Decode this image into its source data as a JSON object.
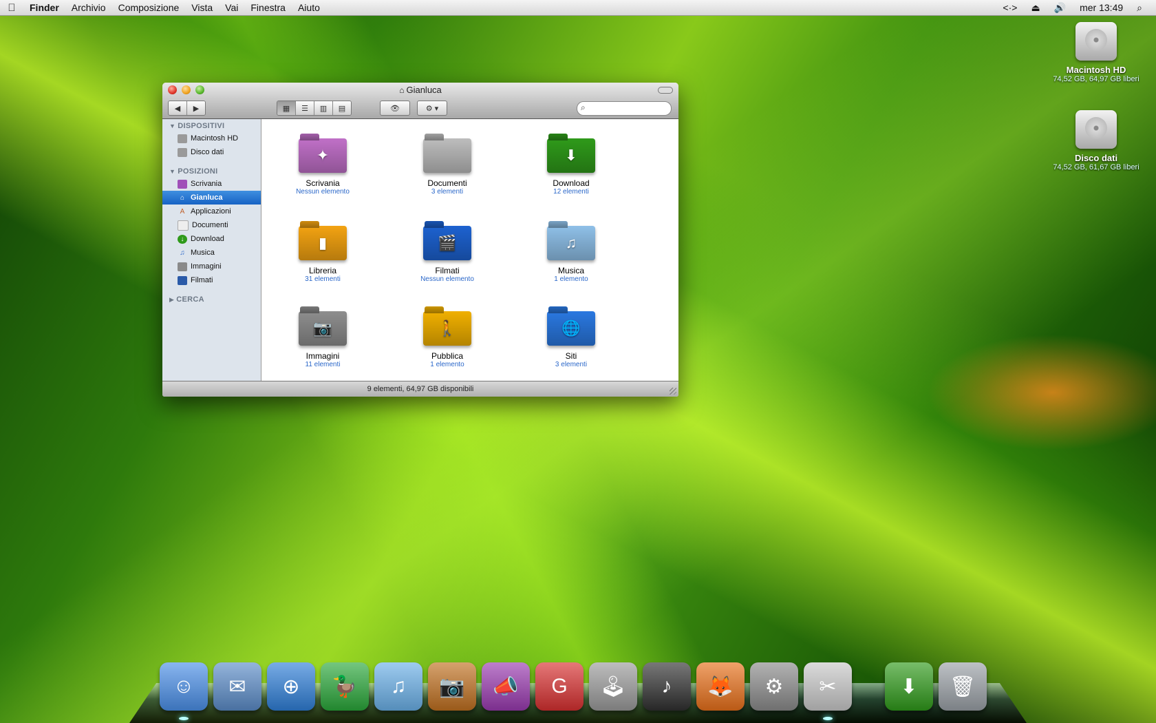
{
  "menubar": {
    "apple": "",
    "app": "Finder",
    "menus": [
      "Archivio",
      "Composizione",
      "Vista",
      "Vai",
      "Finestra",
      "Aiuto"
    ],
    "status": {
      "network": "<·>",
      "eject": "⏏",
      "volume": "🔊",
      "clock": "mer 13:49",
      "spotlight": "⌕"
    }
  },
  "desktop": {
    "drives": [
      {
        "name": "Macintosh HD",
        "info": "74,52 GB, 64,97 GB liberi"
      },
      {
        "name": "Disco dati",
        "info": "74,52 GB, 61,67 GB liberi"
      }
    ]
  },
  "window": {
    "title": "Gianluca",
    "nav": {
      "back": "◀",
      "forward": "▶"
    },
    "views": [
      "▦",
      "☰",
      "▥",
      "▤"
    ],
    "quicklook": "👁",
    "action": "⚙ ▾",
    "search": {
      "value": "",
      "placeholder": ""
    },
    "sidebar": {
      "devices_header": "DISPOSITIVI",
      "devices": [
        "Macintosh HD",
        "Disco dati"
      ],
      "places_header": "POSIZIONI",
      "places": [
        "Scrivania",
        "Gianluca",
        "Applicazioni",
        "Documenti",
        "Download",
        "Musica",
        "Immagini",
        "Filmati"
      ],
      "search_header": "CERCA"
    },
    "items": [
      {
        "name": "Scrivania",
        "sub": "Nessun elemento",
        "color": "#c070c8",
        "glyph": "✦"
      },
      {
        "name": "Documenti",
        "sub": "3 elementi",
        "color": "#bdbdbd",
        "glyph": ""
      },
      {
        "name": "Download",
        "sub": "12 elementi",
        "color": "#2f9a1a",
        "glyph": "⬇"
      },
      {
        "name": "Libreria",
        "sub": "31 elementi",
        "color": "#f3a312",
        "glyph": "▮"
      },
      {
        "name": "Filmati",
        "sub": "Nessun elemento",
        "color": "#1d62d0",
        "glyph": "🎬"
      },
      {
        "name": "Musica",
        "sub": "1 elemento",
        "color": "#8fc0e8",
        "glyph": "♫"
      },
      {
        "name": "Immagini",
        "sub": "11 elementi",
        "color": "#8e8e8e",
        "glyph": "📷"
      },
      {
        "name": "Pubblica",
        "sub": "1 elemento",
        "color": "#f0b000",
        "glyph": "🚶"
      },
      {
        "name": "Siti",
        "sub": "3 elementi",
        "color": "#2a78e0",
        "glyph": "🌐"
      }
    ],
    "status": "9 elementi, 64,97 GB disponibili"
  },
  "dock": {
    "apps": [
      {
        "name": "finder",
        "glyph": "☺",
        "color": "#4a8fe8",
        "running": true
      },
      {
        "name": "mail",
        "glyph": "✉",
        "color": "#5b8cc8",
        "running": false
      },
      {
        "name": "safari",
        "glyph": "⊕",
        "color": "#2f7fd8",
        "running": false
      },
      {
        "name": "adium",
        "glyph": "🦆",
        "color": "#2aa83a",
        "running": false
      },
      {
        "name": "itunes",
        "glyph": "♫",
        "color": "#6ab0e8",
        "running": false
      },
      {
        "name": "iphoto",
        "glyph": "📷",
        "color": "#c07020",
        "running": false
      },
      {
        "name": "podcast",
        "glyph": "📣",
        "color": "#9a3ab0",
        "running": false
      },
      {
        "name": "pdf",
        "glyph": "G",
        "color": "#d83030",
        "running": false
      },
      {
        "name": "joystick",
        "glyph": "🕹",
        "color": "#9a9a9a",
        "running": false
      },
      {
        "name": "garageband",
        "glyph": "♪",
        "color": "#303030",
        "running": false
      },
      {
        "name": "firefox",
        "glyph": "🦊",
        "color": "#e8701a",
        "running": false
      },
      {
        "name": "preferences",
        "glyph": "⚙",
        "color": "#8a8a8a",
        "running": false
      },
      {
        "name": "scissors",
        "glyph": "✂",
        "color": "#c8c8c8",
        "running": true
      }
    ],
    "stacks": [
      {
        "name": "downloads",
        "glyph": "⬇",
        "color": "#2f9a1a"
      },
      {
        "name": "trash",
        "glyph": "🗑",
        "color": "#9aa0a6"
      }
    ]
  }
}
